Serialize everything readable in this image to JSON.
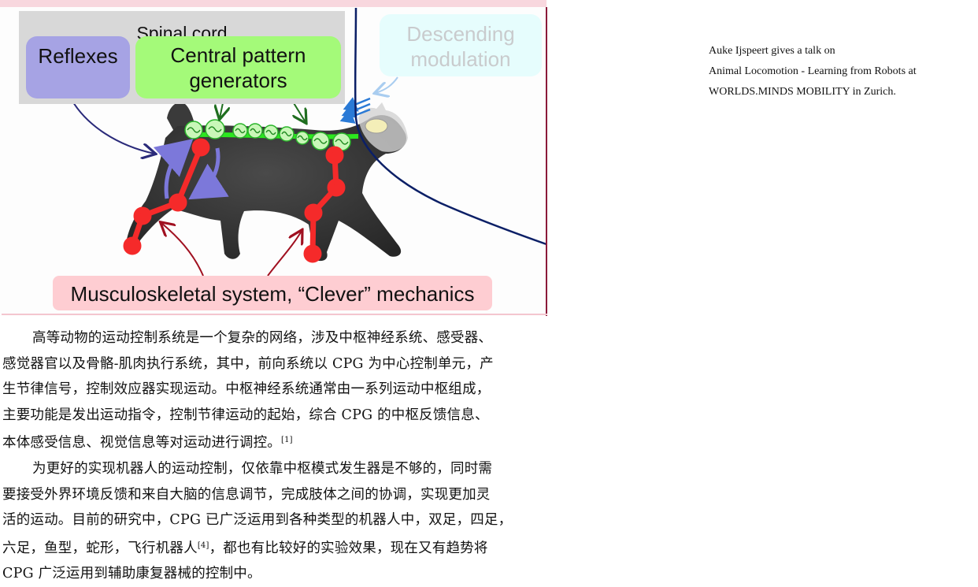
{
  "figure": {
    "spinal_cord_label": "Spinal cord",
    "reflexes_label": "Reflexes",
    "cpg_label_line1": "Central pattern",
    "cpg_label_line2": "generators",
    "descending_label_line1": "Descending",
    "descending_label_line2": "modulation",
    "musculoskeletal_label": "Musculoskeletal system, “Clever” mechanics",
    "colors": {
      "reflexes": "#a6a3e4",
      "cpg": "#a4fa79",
      "descending": "#e6fdfd",
      "musculoskeletal": "#fecdd2",
      "spinal_cord": "#d8d8d8",
      "limb_joints": "#f52a2a",
      "boundary_curve": "#0b1f66"
    }
  },
  "caption": {
    "line1": "Auke Ijspeert gives a talk on",
    "line2": "Animal Locomotion - Learning from Robots at",
    "line3": "WORLDS.MINDS MOBILITY in Zurich."
  },
  "paragraphs": [
    {
      "lines": [
        "高等动物的运动控制系统是一个复杂的网络，涉及中枢神经系统、感受器、",
        "感觉器官以及骨骼-肌肉执行系统，其中，前向系统以 CPG 为中心控制单元，产",
        "生节律信号，控制效应器实现运动。中枢神经系统通常由一系列运动中枢组成，",
        "主要功能是发出运动指令，控制节律运动的起始，综合 CPG 的中枢反馈信息、",
        "本体感受信息、视觉信息等对运动进行调控。"
      ],
      "citation": "[1]"
    },
    {
      "lines": [
        "为更好的实现机器人的运动控制，仅依靠中枢模式发生器是不够的，同时需",
        "要接受外界环境反馈和来自大脑的信息调节，完成肢体之间的协调，实现更加灵",
        "活的运动。目前的研究中，CPG 已广泛运用到各种类型的机器人中，双足，四足，",
        "六足，鱼型，蛇形，飞行机器人",
        "CPG 广泛运用到辅助康复器械的控制中。"
      ],
      "citation": "[4]",
      "line4_after_citation": "，都也有比较好的实验效果，现在又有趋势将"
    }
  ]
}
